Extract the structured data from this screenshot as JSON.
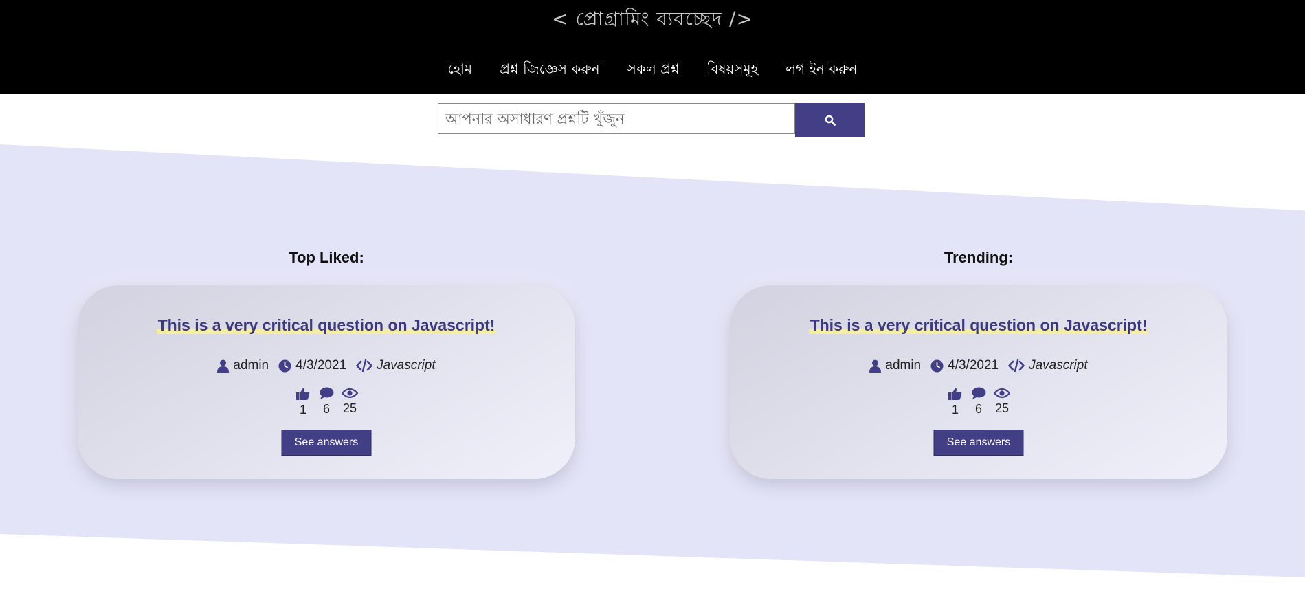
{
  "brand": {
    "title": "< প্রোগ্রামিং ব্যবচ্ছেদ />"
  },
  "nav": {
    "items": [
      {
        "label": "হোম"
      },
      {
        "label": "প্রশ্ন জিজ্ঞেস করুন"
      },
      {
        "label": "সকল প্রশ্ন"
      },
      {
        "label": "বিষয়সমূহ"
      },
      {
        "label": "লগ ইন করুন"
      }
    ]
  },
  "search": {
    "placeholder": "আপনার অসাধারণ প্রশ্নটি খুঁজুন",
    "value": "",
    "icon": "search-icon"
  },
  "colors": {
    "accent": "#423f86",
    "band": "#e4e4f8",
    "header": "#000000",
    "highlight": "#f4ef9e"
  },
  "sections": [
    {
      "heading": "Top Liked:",
      "card": {
        "title": "This is a very critical question on Javascript!",
        "author": "admin",
        "date": "4/3/2021",
        "tag": "Javascript",
        "likes": "1",
        "comments": "6",
        "views": "25",
        "button": "See answers"
      }
    },
    {
      "heading": "Trending:",
      "card": {
        "title": "This is a very critical question on Javascript!",
        "author": "admin",
        "date": "4/3/2021",
        "tag": "Javascript",
        "likes": "1",
        "comments": "6",
        "views": "25",
        "button": "See answers"
      }
    }
  ]
}
